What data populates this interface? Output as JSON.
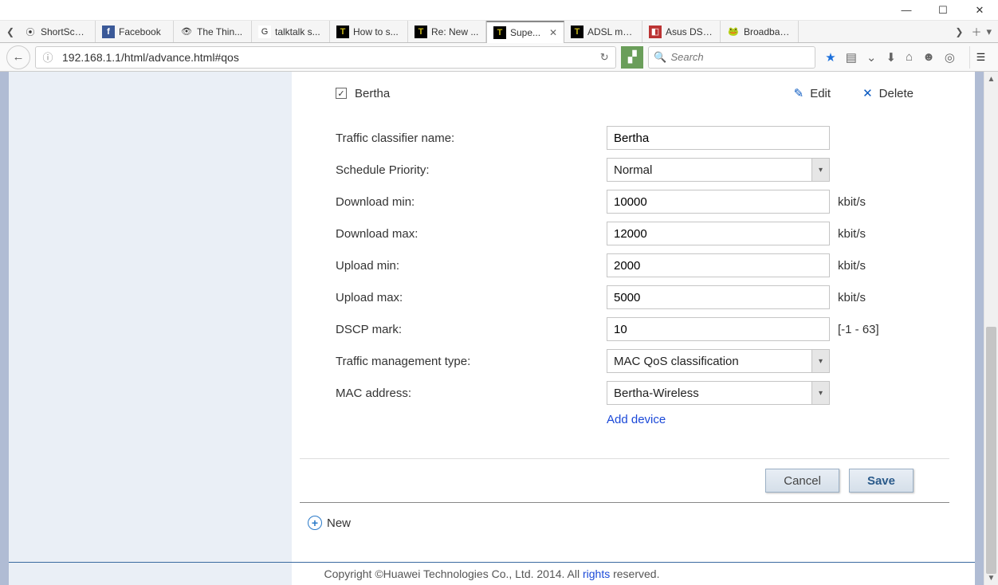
{
  "window": {
    "title": ""
  },
  "tabs": [
    {
      "label": "ShortScal..."
    },
    {
      "label": "Facebook"
    },
    {
      "label": "The Thin..."
    },
    {
      "label": "talktalk s..."
    },
    {
      "label": "How to s..."
    },
    {
      "label": "Re: New ..."
    },
    {
      "label": "Supe..."
    },
    {
      "label": "ADSL mo..."
    },
    {
      "label": "Asus DSL..."
    },
    {
      "label": "Broadban..."
    }
  ],
  "url": "192.168.1.1/html/advance.html#qos",
  "search_placeholder": "Search",
  "rule": {
    "name": "Bertha",
    "edit": "Edit",
    "delete": "Delete"
  },
  "form": {
    "labels": {
      "classifier": "Traffic classifier name:",
      "priority": "Schedule Priority:",
      "dl_min": "Download min:",
      "dl_max": "Download max:",
      "ul_min": "Upload min:",
      "ul_max": "Upload max:",
      "dscp": "DSCP mark:",
      "mgmt": "Traffic management type:",
      "mac": "MAC address:"
    },
    "values": {
      "classifier": "Bertha",
      "priority": "Normal",
      "dl_min": "10000",
      "dl_max": "12000",
      "ul_min": "2000",
      "ul_max": "5000",
      "dscp": "10",
      "mgmt": "MAC QoS classification",
      "mac": "Bertha-Wireless"
    },
    "suffix_kbits": "kbit/s",
    "suffix_dscp": "[-1 - 63]",
    "add_device": "Add device"
  },
  "buttons": {
    "cancel": "Cancel",
    "save": "Save",
    "new": "New"
  },
  "footer": {
    "prefix": "Copyright ©Huawei Technologies Co., Ltd. 2014. All ",
    "link": "rights",
    "suffix": " reserved."
  }
}
